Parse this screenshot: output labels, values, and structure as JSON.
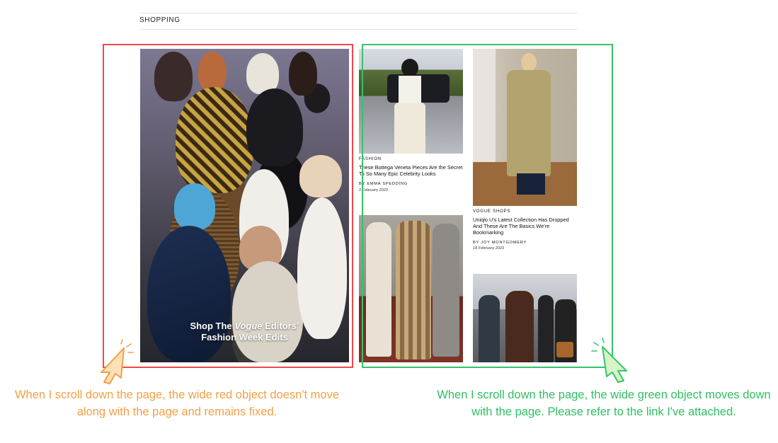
{
  "section": {
    "title": "SHOPPING"
  },
  "feature": {
    "caption_line1_prefix": "Shop The ",
    "caption_line1_italic": "Vogue",
    "caption_line1_suffix": " Editors’",
    "caption_line2": "Fashion Week Edits"
  },
  "articles": [
    {
      "category": "FASHION",
      "title": "These Bottega Veneta Pieces Are the Secret To So Many Epic Celebrity Looks",
      "byline": "BY EMMA SPEDDING",
      "date": "2 February 2023"
    },
    {
      "category": "VOGUE SHOPS",
      "title": "Uniqlo U's Latest Collection Has Dropped And These Are The Basics We're Bookmarking",
      "byline": "BY JOY MONTGOMERY",
      "date": "18 February 2023"
    },
    {
      "category": "",
      "title": "",
      "byline": "",
      "date": ""
    },
    {
      "category": "",
      "title": "",
      "byline": "",
      "date": ""
    }
  ],
  "annotations": {
    "left_note": "When I scroll down the page, the wide red object doesn't move along with the page and remains fixed.",
    "right_note": "When I scroll down the page, the wide green object moves down with the page. Please refer to the link I've attached."
  },
  "colors": {
    "red_outline": "#f24848",
    "green_outline": "#36c36a",
    "orange_text": "#f2a046",
    "green_text": "#2fbf60"
  },
  "icons": [
    "click-cursor-icon"
  ]
}
